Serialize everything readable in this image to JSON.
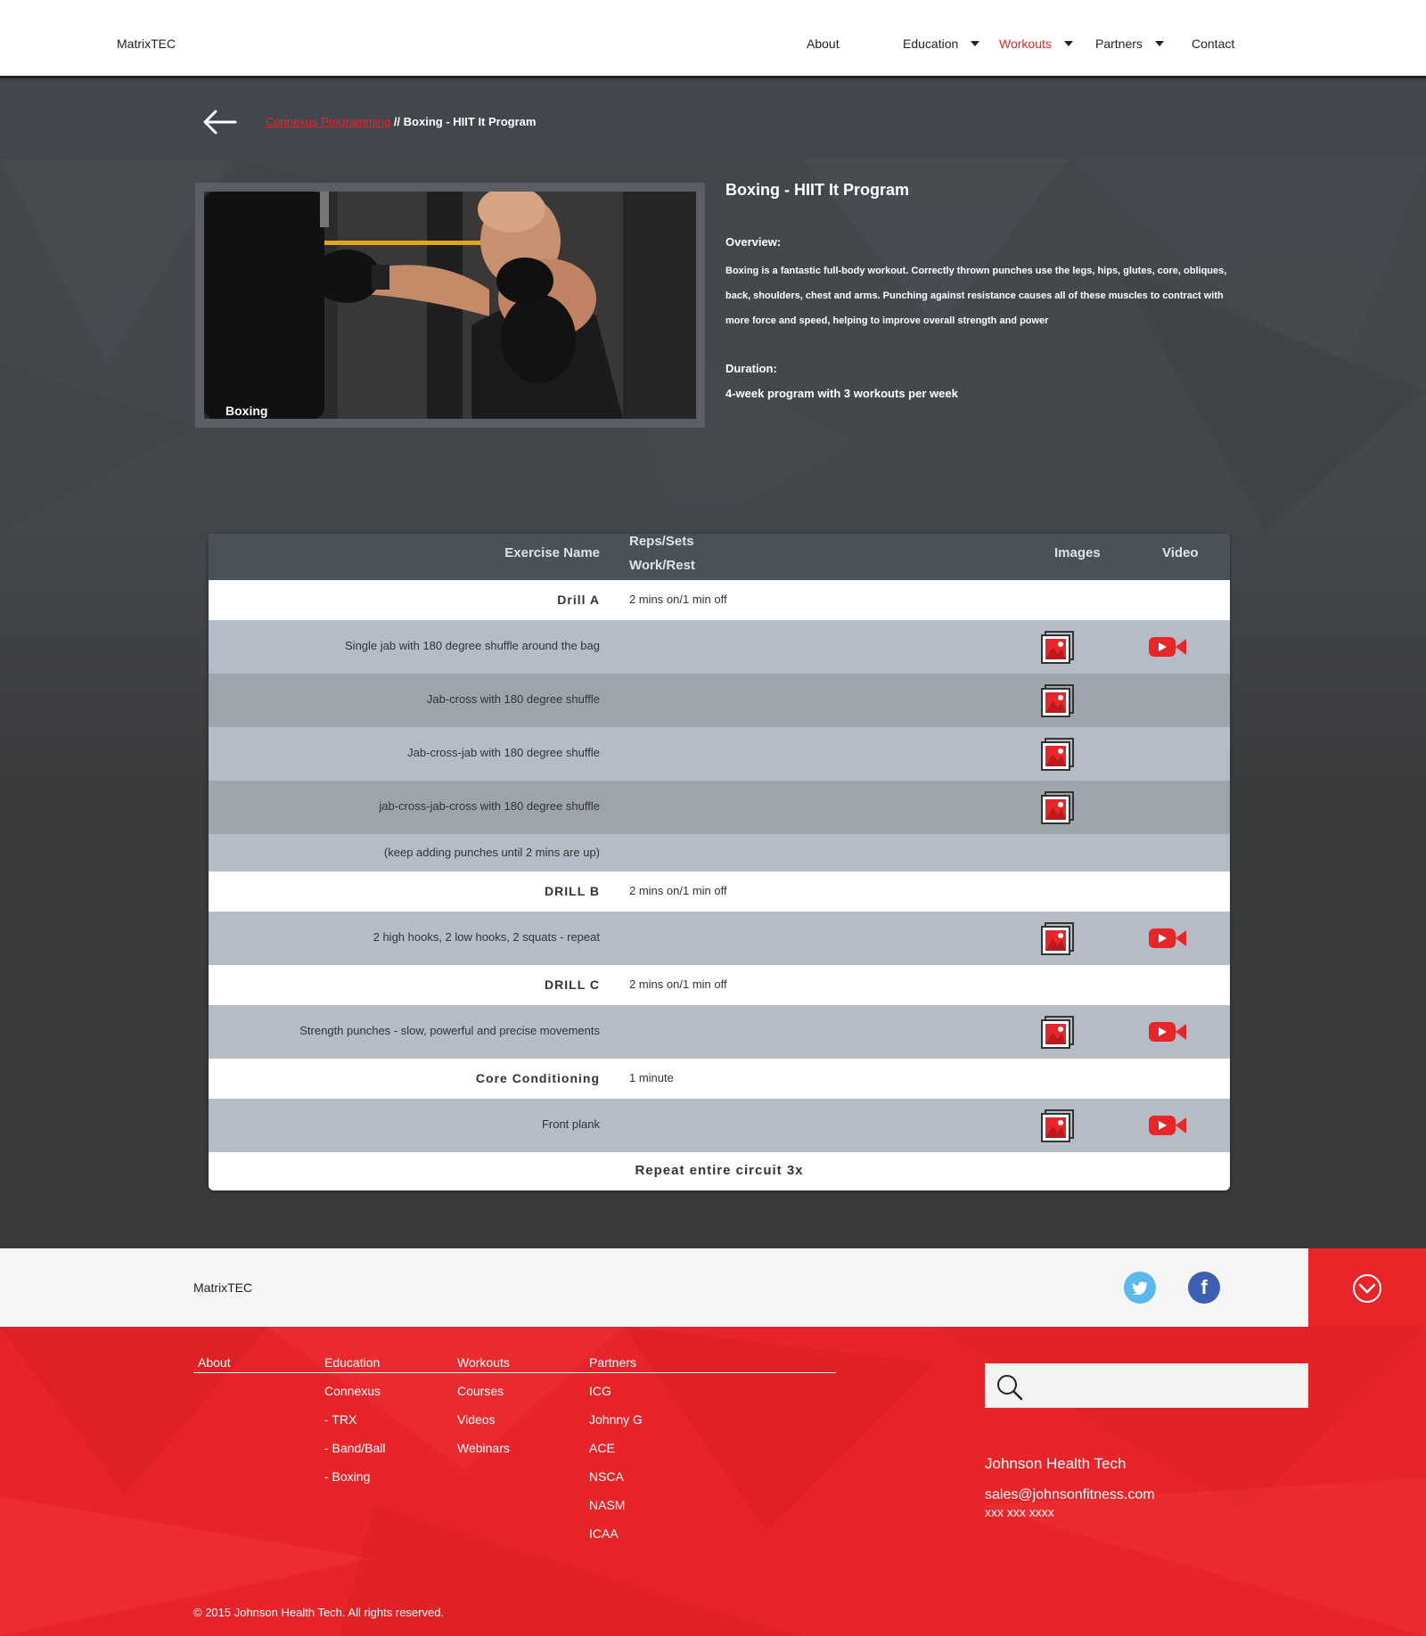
{
  "nav": {
    "brand": "MatrixTEC",
    "items": [
      {
        "label": "About",
        "has_dropdown": false,
        "active": false
      },
      {
        "label": "Education",
        "has_dropdown": true,
        "active": false
      },
      {
        "label": "Workouts",
        "has_dropdown": true,
        "active": true
      },
      {
        "label": "Partners",
        "has_dropdown": true,
        "active": false
      },
      {
        "label": "Contact",
        "has_dropdown": false,
        "active": false
      }
    ],
    "active_color": "#e8262a"
  },
  "breadcrumb": {
    "parent": "Connexus Programming",
    "separator": "//",
    "current": "Boxing - HIIT It Program"
  },
  "program": {
    "image_caption": "Boxing",
    "title": "Boxing - HIIT It Program",
    "overview_label": "Overview:",
    "overview_text": "Boxing is a fantastic full-body workout. Correctly thrown punches use the legs, hips, glutes, core, obliques, back, shoulders, chest and arms. Punching against resistance causes all of these muscles to contract with more force and speed, helping to improve overall strength and power",
    "duration_label": "Duration:",
    "duration_text": "4-week program with 3 workouts per week"
  },
  "table": {
    "headers": {
      "name": "Exercise Name",
      "reps_line1": "Reps/Sets",
      "reps_line2": "Work/Rest",
      "images": "Images",
      "video": "Video"
    },
    "rows": [
      {
        "name": "Drill A",
        "reps": "2 mins on/1 min off",
        "kind": "section",
        "image": false,
        "video": false
      },
      {
        "name": "Single jab with 180 degree shuffle around the bag",
        "reps": "",
        "kind": "exercise",
        "image": true,
        "video": true
      },
      {
        "name": "Jab-cross with 180 degree shuffle",
        "reps": "",
        "kind": "exercise",
        "image": true,
        "video": false
      },
      {
        "name": "Jab-cross-jab with 180 degree shuffle",
        "reps": "",
        "kind": "exercise",
        "image": true,
        "video": false
      },
      {
        "name": "jab-cross-jab-cross with 180 degree shuffle",
        "reps": "",
        "kind": "exercise",
        "image": true,
        "video": false
      },
      {
        "name": "(keep adding punches until 2 mins are up)",
        "reps": "",
        "kind": "note",
        "image": false,
        "video": false
      },
      {
        "name": "DRILL B",
        "reps": "2 mins on/1 min off",
        "kind": "section",
        "image": false,
        "video": false
      },
      {
        "name": "2 high hooks, 2 low hooks, 2 squats - repeat",
        "reps": "",
        "kind": "exercise",
        "image": true,
        "video": true
      },
      {
        "name": "DRILL C",
        "reps": "2 mins on/1 min off",
        "kind": "section",
        "image": false,
        "video": false
      },
      {
        "name": "Strength punches - slow, powerful and precise movements",
        "reps": "",
        "kind": "exercise",
        "image": true,
        "video": true
      },
      {
        "name": "Core Conditioning",
        "reps": "1 minute",
        "kind": "section",
        "image": false,
        "video": false
      },
      {
        "name": "Front plank",
        "reps": "",
        "kind": "exercise",
        "image": true,
        "video": true
      }
    ],
    "footer": "Repeat entire circuit 3x",
    "icon_color": "#e8262a"
  },
  "footer": {
    "brand": "MatrixTEC",
    "social": [
      {
        "name": "twitter",
        "icon": "twitter-icon",
        "color": "#5ab8ea"
      },
      {
        "name": "facebook",
        "icon": "facebook-icon",
        "color": "#3d5fb0"
      }
    ],
    "columns": [
      {
        "heading": "About",
        "links": []
      },
      {
        "heading": "Education",
        "links": [
          "Connexus",
          "- TRX",
          "- Band/Ball",
          "- Boxing"
        ]
      },
      {
        "heading": "Workouts",
        "links": [
          "Courses",
          "Videos",
          "Webinars"
        ]
      },
      {
        "heading": "Partners",
        "links": [
          "ICG",
          "Johnny G",
          "ACE",
          "NSCA",
          "NASM",
          "ICAA"
        ]
      }
    ],
    "search_placeholder": "",
    "company": "Johnson Health Tech",
    "email": "sales@johnsonfitness.com",
    "phone": "xxx xxx xxxx",
    "copyright": "© 2015 Johnson Health Tech. All rights reserved.",
    "background_color": "#e62429"
  }
}
